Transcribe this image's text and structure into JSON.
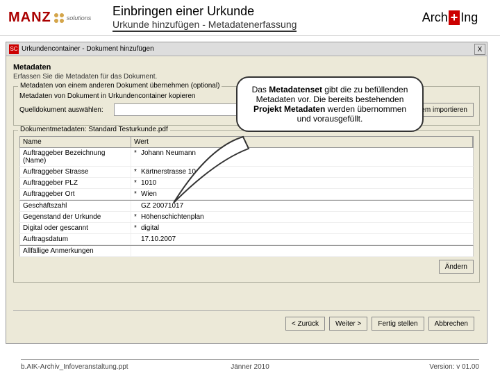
{
  "header": {
    "logo_left_text": "MANZ",
    "logo_left_sub": "solutions",
    "title": "Einbringen einer Urkunde",
    "subtitle": "Urkunde hinzufügen - Metadatenerfassung",
    "logo_right_arch": "Arch",
    "logo_right_plus": "+",
    "logo_right_ing": "Ing"
  },
  "dialog": {
    "title": "Urkundencontainer - Dokument hinzufügen",
    "close": "X",
    "section_title": "Metadaten",
    "section_desc": "Erfassen Sie die Metadaten für das Dokument.",
    "group1_label": "Metadaten von einem anderen Dokument übernehmen (optional)",
    "group1_desc": "Metadaten von Dokument in Urkundencontainer kopieren",
    "source_label": "Quelldokument auswählen:",
    "import_btn": "Aus dem Dateisystem importieren",
    "group2_label": "Dokumentmetadaten: Standard Testurkunde.pdf",
    "col_name": "Name",
    "col_wert": "Wert",
    "rows": [
      {
        "name": "Auftraggeber Bezeichnung (Name)",
        "req": "*",
        "val": "Johann Neumann"
      },
      {
        "name": "Auftraggeber Strasse",
        "req": "*",
        "val": "Kärtnerstrasse 10"
      },
      {
        "name": "Auftraggeber PLZ",
        "req": "*",
        "val": "1010"
      },
      {
        "name": "Auftraggeber Ort",
        "req": "*",
        "val": "Wien"
      },
      {
        "name": "Geschäftszahl",
        "req": "",
        "val": "GZ 20071017"
      },
      {
        "name": "Gegenstand der Urkunde",
        "req": "*",
        "val": "Höhenschichtenplan"
      },
      {
        "name": "Digital oder gescannt",
        "req": "*",
        "val": "digital"
      },
      {
        "name": "Auftragsdatum",
        "req": "",
        "val": "17.10.2007"
      },
      {
        "name": "Allfällige Anmerkungen",
        "req": "",
        "val": ""
      }
    ],
    "andern_btn": "Ändern",
    "btn_back": "< Zurück",
    "btn_next": "Weiter >",
    "btn_finish": "Fertig stellen",
    "btn_cancel": "Abbrechen"
  },
  "callout": {
    "text_parts": [
      "Das ",
      "Metadatenset",
      " gibt die zu befüllenden Metadaten vor. Die bereits bestehenden ",
      "Projekt Metadaten",
      " werden übernommen und vorausgefüllt."
    ]
  },
  "footer": {
    "left": "b.AIK-Archiv_Infoveranstaltung.ppt",
    "center": "Jänner 2010",
    "right": "Version: v 01.00"
  }
}
